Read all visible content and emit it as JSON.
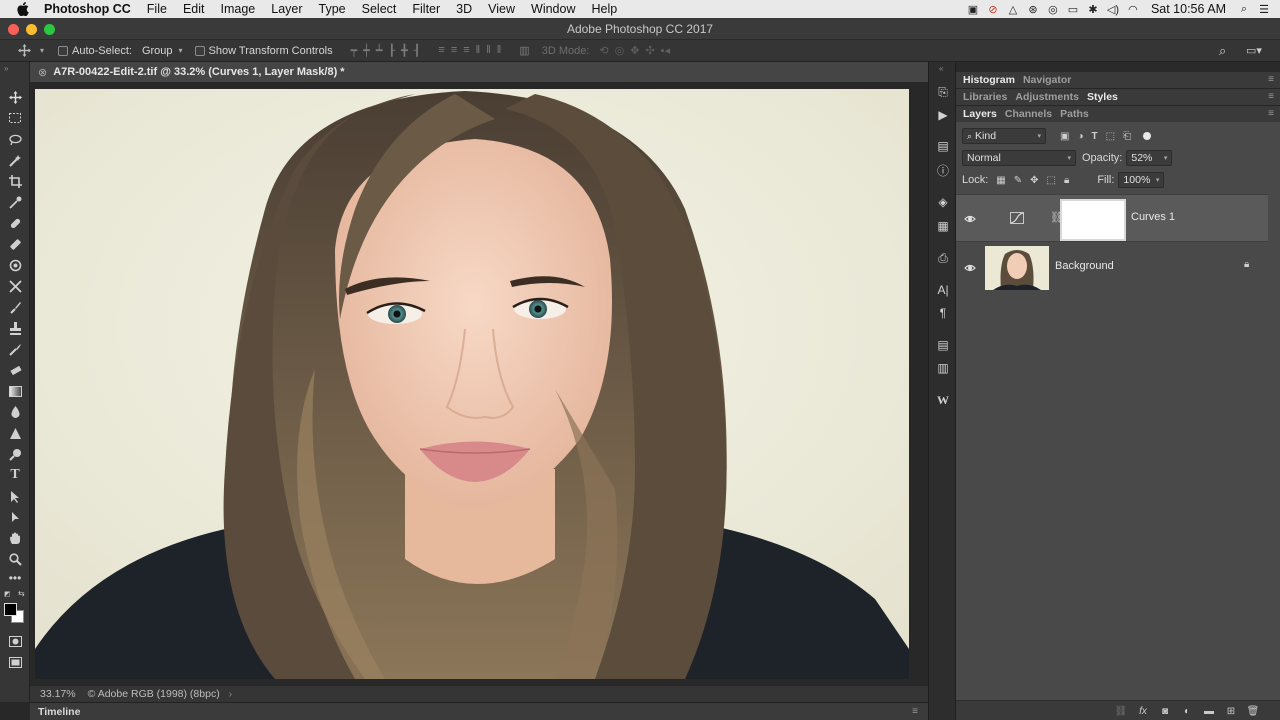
{
  "menubar": {
    "app_name": "Photoshop CC",
    "items": [
      "File",
      "Edit",
      "Image",
      "Layer",
      "Type",
      "Select",
      "Filter",
      "3D",
      "View",
      "Window",
      "Help"
    ],
    "clock": "Sat 10:56 AM"
  },
  "window": {
    "title": "Adobe Photoshop CC 2017"
  },
  "options_bar": {
    "auto_select_label": "Auto-Select:",
    "auto_select_value": "Group",
    "show_transform_label": "Show Transform Controls",
    "mode_3d_label": "3D Mode:"
  },
  "document": {
    "tab_title": "A7R-00422-Edit-2.tif @ 33.2% (Curves 1, Layer Mask/8) *",
    "zoom": "33.17%",
    "color_profile": "Adobe RGB (1998) (8bpc)"
  },
  "timeline": {
    "label": "Timeline"
  },
  "panels": {
    "row1": {
      "tabs": [
        "Histogram",
        "Navigator"
      ],
      "active": "Histogram"
    },
    "row2": {
      "tabs": [
        "Libraries",
        "Adjustments",
        "Styles"
      ],
      "active": "Styles"
    },
    "row3": {
      "tabs": [
        "Layers",
        "Channels",
        "Paths"
      ],
      "active": "Layers"
    }
  },
  "layers": {
    "filter_kind": "Kind",
    "blend_mode": "Normal",
    "opacity_label": "Opacity:",
    "opacity_value": "52%",
    "lock_label": "Lock:",
    "fill_label": "Fill:",
    "fill_value": "100%",
    "items": [
      {
        "name": "Curves 1",
        "type": "adjustment",
        "selected": true
      },
      {
        "name": "Background",
        "type": "image",
        "locked": true
      }
    ]
  },
  "colors": {
    "accent_close": "#fc5f57",
    "accent_min": "#fdbc2e",
    "accent_max": "#29c840",
    "panel_bg": "#494949",
    "canvas_bg": "#282828"
  }
}
